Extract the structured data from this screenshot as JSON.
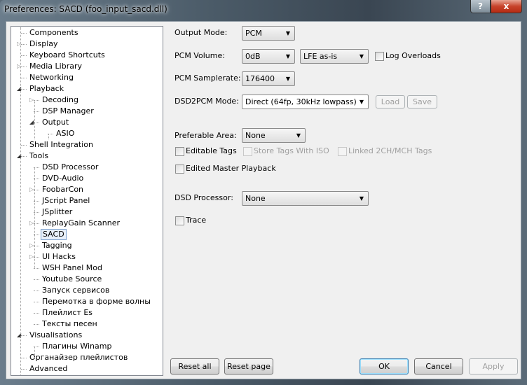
{
  "window": {
    "title": "Preferences: SACD (foo_input_sacd.dll)",
    "help_label": "?",
    "close_label": "x"
  },
  "tree": [
    {
      "label": "Components",
      "level": 0,
      "expander": "none"
    },
    {
      "label": "Display",
      "level": 0,
      "expander": "closed"
    },
    {
      "label": "Keyboard Shortcuts",
      "level": 0,
      "expander": "none"
    },
    {
      "label": "Media Library",
      "level": 0,
      "expander": "closed"
    },
    {
      "label": "Networking",
      "level": 0,
      "expander": "none"
    },
    {
      "label": "Playback",
      "level": 0,
      "expander": "open"
    },
    {
      "label": "Decoding",
      "level": 1,
      "expander": "closed"
    },
    {
      "label": "DSP Manager",
      "level": 1,
      "expander": "none"
    },
    {
      "label": "Output",
      "level": 1,
      "expander": "open"
    },
    {
      "label": "ASIO",
      "level": 2,
      "expander": "none"
    },
    {
      "label": "Shell Integration",
      "level": 0,
      "expander": "none"
    },
    {
      "label": "Tools",
      "level": 0,
      "expander": "open"
    },
    {
      "label": "DSD Processor",
      "level": 1,
      "expander": "none"
    },
    {
      "label": "DVD-Audio",
      "level": 1,
      "expander": "none"
    },
    {
      "label": "FoobarCon",
      "level": 1,
      "expander": "closed"
    },
    {
      "label": "JScript Panel",
      "level": 1,
      "expander": "none"
    },
    {
      "label": "JSplitter",
      "level": 1,
      "expander": "none"
    },
    {
      "label": "ReplayGain Scanner",
      "level": 1,
      "expander": "closed"
    },
    {
      "label": "SACD",
      "level": 1,
      "expander": "none",
      "selected": true
    },
    {
      "label": "Tagging",
      "level": 1,
      "expander": "closed"
    },
    {
      "label": "UI Hacks",
      "level": 1,
      "expander": "closed"
    },
    {
      "label": "WSH Panel Mod",
      "level": 1,
      "expander": "none"
    },
    {
      "label": "Youtube Source",
      "level": 1,
      "expander": "none"
    },
    {
      "label": "Запуск сервисов",
      "level": 1,
      "expander": "none"
    },
    {
      "label": "Перемотка в форме волны",
      "level": 1,
      "expander": "none"
    },
    {
      "label": "Плейлист Es",
      "level": 1,
      "expander": "none"
    },
    {
      "label": "Тексты песен",
      "level": 1,
      "expander": "none"
    },
    {
      "label": "Visualisations",
      "level": 0,
      "expander": "open"
    },
    {
      "label": "Плагины Winamp",
      "level": 1,
      "expander": "none"
    },
    {
      "label": "Органайзер плейлистов",
      "level": 0,
      "expander": "none"
    },
    {
      "label": "Advanced",
      "level": 0,
      "expander": "none"
    }
  ],
  "settings": {
    "output_mode_label": "Output Mode:",
    "output_mode_value": "PCM",
    "pcm_volume_label": "PCM Volume:",
    "pcm_volume_value": "0dB",
    "lfe_value": "LFE as-is",
    "log_overloads_label": "Log Overloads",
    "pcm_samplerate_label": "PCM Samplerate:",
    "pcm_samplerate_value": "176400",
    "dsd2pcm_label": "DSD2PCM Mode:",
    "dsd2pcm_value": "Direct (64fp, 30kHz lowpass)",
    "load_label": "Load",
    "save_label": "Save",
    "preferable_area_label": "Preferable Area:",
    "preferable_area_value": "None",
    "editable_tags_label": "Editable Tags",
    "store_tags_label": "Store Tags With ISO",
    "linked_tags_label": "Linked 2CH/MCH Tags",
    "edited_master_label": "Edited Master Playback",
    "dsd_processor_label": "DSD Processor:",
    "dsd_processor_value": "None",
    "trace_label": "Trace"
  },
  "buttons": {
    "reset_all": "Reset all",
    "reset_page": "Reset page",
    "ok": "OK",
    "cancel": "Cancel",
    "apply": "Apply"
  },
  "dropdown_arrow": "▼"
}
